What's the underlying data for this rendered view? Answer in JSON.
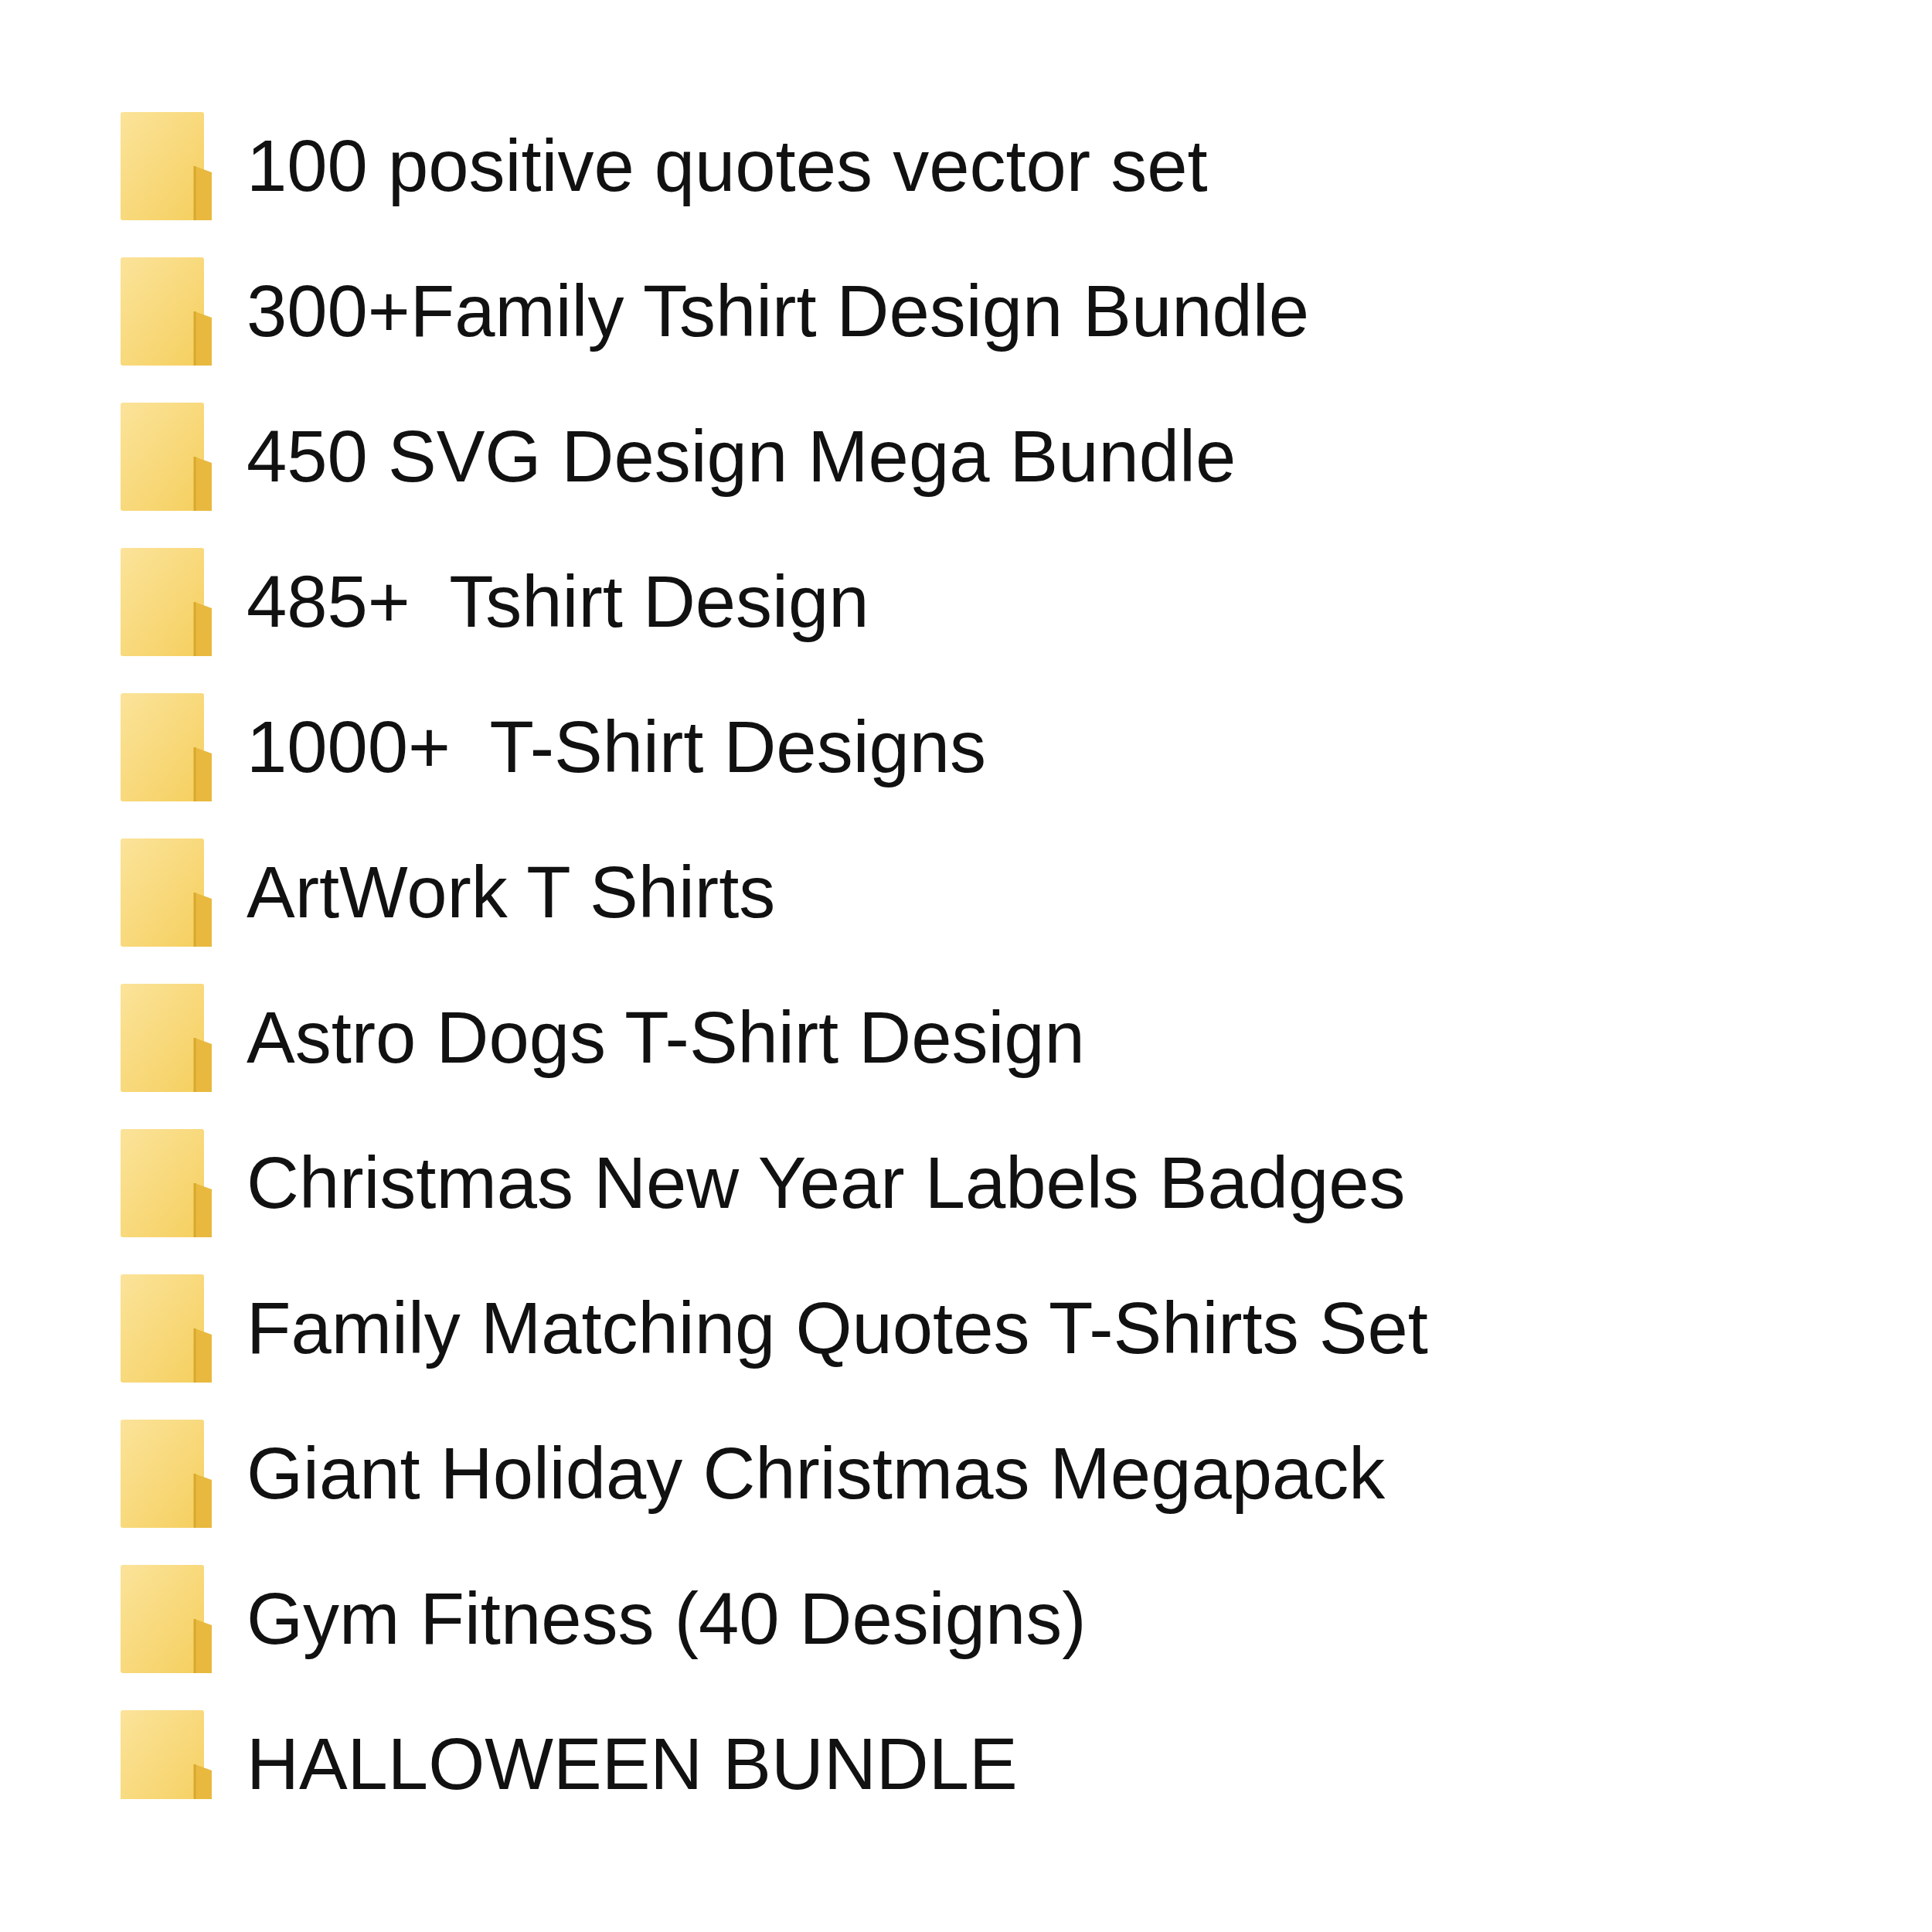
{
  "folders": [
    {
      "name": "100 positive quotes vector set"
    },
    {
      "name": "300+Family Tshirt Design Bundle"
    },
    {
      "name": "450 SVG Design Mega Bundle"
    },
    {
      "name": "485+  Tshirt Design"
    },
    {
      "name": "1000+  T-Shirt Designs"
    },
    {
      "name": "ArtWork T Shirts"
    },
    {
      "name": "Astro Dogs T-Shirt Design"
    },
    {
      "name": "Christmas New Year Labels Badges"
    },
    {
      "name": "Family Matching Quotes T-Shirts Set"
    },
    {
      "name": "Giant Holiday Christmas Megapack"
    },
    {
      "name": "Gym Fitness (40 Designs)"
    },
    {
      "name": "HALLOWEEN BUNDLE"
    }
  ]
}
